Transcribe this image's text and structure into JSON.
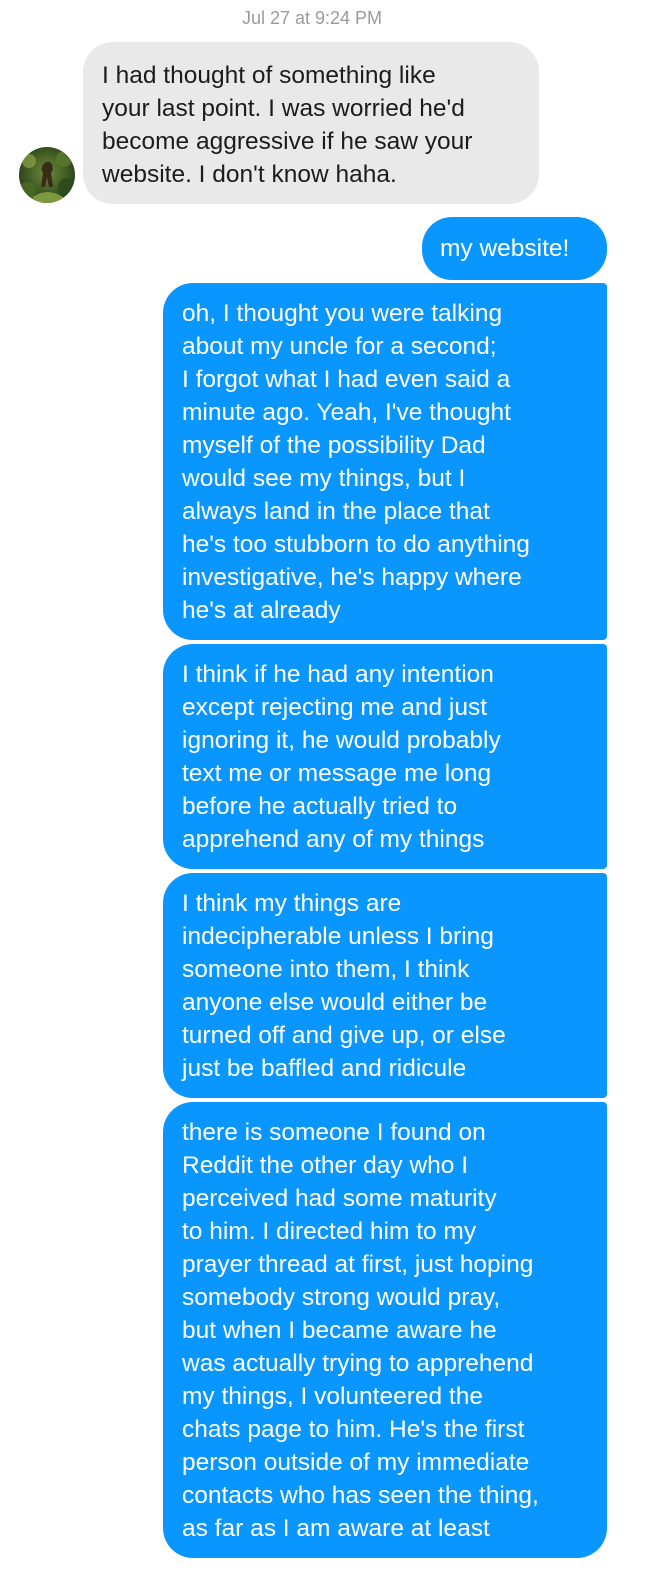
{
  "conversation": {
    "timestamp": "Jul 27 at 9:24 PM",
    "incoming": [
      {
        "sender_avatar": "contact-avatar",
        "text": "I had thought of something like\nyour last point. I was worried he'd\nbecome aggressive if he saw your\nwebsite. I don't know haha."
      }
    ],
    "outgoing": [
      {
        "text": "my website!"
      },
      {
        "text": "oh, I thought you were talking\nabout my uncle for a second;\nI forgot what I had even said a\nminute ago. Yeah, I've thought\nmyself of the possibility Dad\nwould see my things, but I\nalways land in the place that\nhe's too stubborn to do anything\ninvestigative, he's happy where\nhe's at already"
      },
      {
        "text": "I think if he had any intention\nexcept rejecting me and just\nignoring it, he would probably\ntext me or message me long\nbefore he actually tried to\napprehend any of my things"
      },
      {
        "text": "I think my things are\nindecipherable unless I bring\nsomeone into them, I think\nanyone else would either be\nturned off and give up, or else\njust be baffled and ridicule"
      },
      {
        "text": "there is someone I found on\nReddit the other day who I\nperceived had some maturity\nto him. I directed him to my\nprayer thread at first, just hoping\nsomebody strong would pray,\nbut when I became aware he\nwas actually trying to apprehend\nmy things, I volunteered the\nchats page to him. He's the first\nperson outside of my immediate\ncontacts who has seen the thing,\nas far as I am aware at least"
      }
    ]
  },
  "colors": {
    "outgoing_bubble": "#0a96ff",
    "incoming_bubble": "#e9e9e9",
    "timestamp_text": "#9a9a9a"
  }
}
